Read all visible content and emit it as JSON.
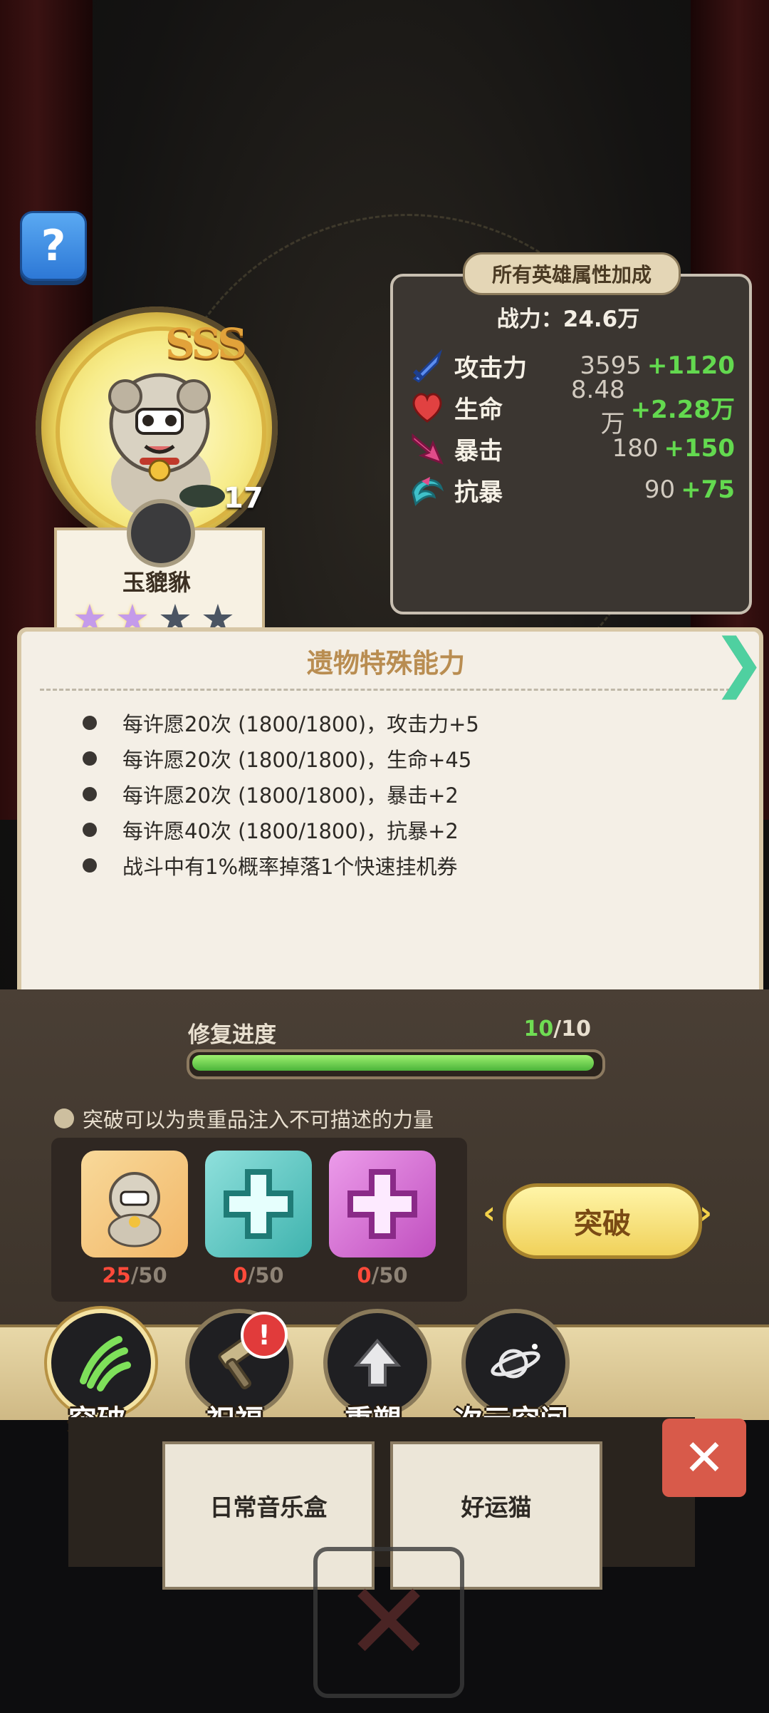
{
  "help": {
    "label": "?"
  },
  "hero": {
    "rank": "SSS",
    "level": "17",
    "name": "玉貔貅",
    "stars_filled": 2,
    "stars_total": 4
  },
  "stats": {
    "tab_label": "所有英雄属性加成",
    "power_label": "战力：",
    "power_value": "24.6万",
    "rows": [
      {
        "icon": "sword-icon",
        "name": "攻击力",
        "base": "3595",
        "bonus": "+1120",
        "color": "#5b8df0"
      },
      {
        "icon": "heart-icon",
        "name": "生命",
        "base": "8.48万",
        "bonus": "+2.28万",
        "color": "#e14141"
      },
      {
        "icon": "crit-arrow-icon",
        "name": "暴击",
        "base": "180",
        "bonus": "+150",
        "color": "#e04c8a"
      },
      {
        "icon": "shield-swirl-icon",
        "name": "抗暴",
        "base": "90",
        "bonus": "+75",
        "color": "#3fc0c9"
      }
    ]
  },
  "relic": {
    "title": "遗物特殊能力",
    "items": [
      "每许愿20次 (1800/1800)，攻击力+5",
      "每许愿20次 (1800/1800)，生命+45",
      "每许愿20次 (1800/1800)，暴击+2",
      "每许愿40次 (1800/1800)，抗暴+2",
      "战斗中有1%概率掉落1个快速挂机券"
    ]
  },
  "repair": {
    "label": "修复进度",
    "current": "10",
    "total": "/10",
    "fraction": 1.0
  },
  "breakthrough": {
    "tip": "突破可以为贵重品注入不可描述的力量",
    "materials": [
      {
        "name": "hero-shard",
        "current": "25",
        "total": "/50",
        "color": "#f5c37a"
      },
      {
        "name": "cyan-puzzle-shard",
        "current": "0",
        "total": "/50",
        "color": "#58c8c4"
      },
      {
        "name": "pink-puzzle-shard",
        "current": "0",
        "total": "/50",
        "color": "#d773d6"
      }
    ],
    "button": "突破"
  },
  "tabs": [
    {
      "label": "突破",
      "icon": "claw-icon",
      "active": true,
      "badge": ""
    },
    {
      "label": "祝福",
      "icon": "hammer-icon",
      "active": false,
      "badge": "!"
    },
    {
      "label": "重塑",
      "icon": "arrow-up-icon",
      "active": false,
      "badge": ""
    },
    {
      "label": "次元空间",
      "icon": "planet-icon",
      "active": false,
      "badge": ""
    }
  ],
  "shelf": {
    "cards": [
      {
        "name": "日常音乐盒"
      },
      {
        "name": "好运猫"
      }
    ]
  },
  "close_label": "✕"
}
